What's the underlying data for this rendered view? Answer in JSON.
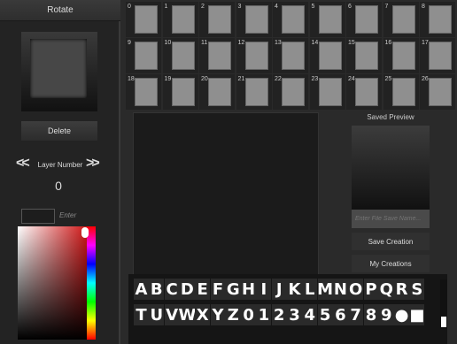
{
  "left_panel": {
    "rotate_label": "Rotate",
    "delete_label": "Delete",
    "layer_label": "Layer Number",
    "layer_number": "0",
    "prev_symbol": "<<",
    "next_symbol": ">>",
    "color_enter_placeholder": "Enter"
  },
  "slots": [
    "0",
    "1",
    "2",
    "3",
    "4",
    "5",
    "6",
    "7",
    "8",
    "9",
    "10",
    "11",
    "12",
    "13",
    "14",
    "15",
    "16",
    "17",
    "18",
    "19",
    "20",
    "21",
    "22",
    "23",
    "24",
    "25",
    "26"
  ],
  "save": {
    "title": "Saved Preview",
    "filename_placeholder": "Enter File Save Name...",
    "save_label": "Save Creation",
    "creations_label": "My Creations"
  },
  "keyboard": {
    "row1": [
      "A",
      "B",
      "C",
      "D",
      "E",
      "F",
      "G",
      "H",
      "I",
      "J",
      "K",
      "L",
      "M",
      "N",
      "O",
      "P",
      "Q",
      "R",
      "S"
    ],
    "row2": [
      "T",
      "U",
      "V",
      "W",
      "X",
      "Y",
      "Z",
      "0",
      "1",
      "2",
      "3",
      "4",
      "5",
      "6",
      "7",
      "8",
      "9",
      "●",
      "■"
    ]
  }
}
